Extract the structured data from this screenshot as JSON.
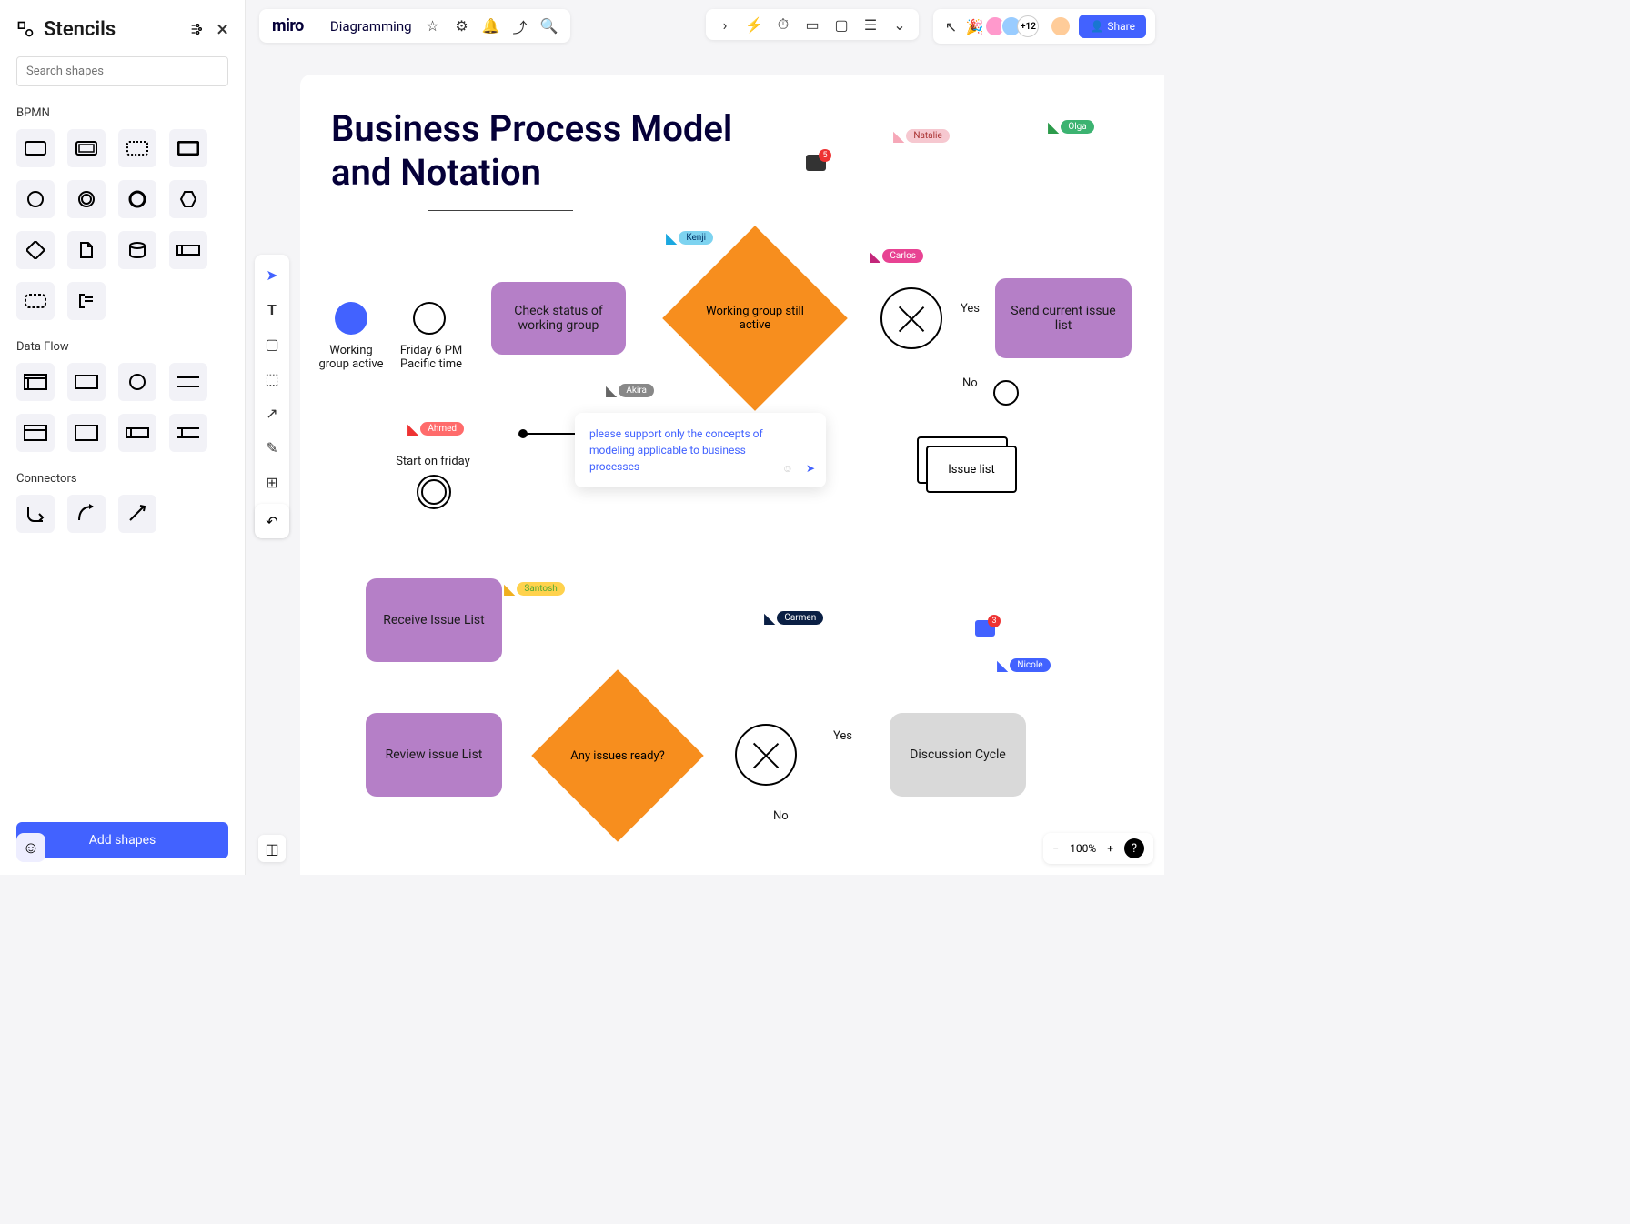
{
  "sidebar": {
    "title": "Stencils",
    "search_placeholder": "Search shapes",
    "sections": {
      "bpmn": "BPMN",
      "dataflow": "Data Flow",
      "connectors": "Connectors"
    },
    "add_shapes": "Add shapes"
  },
  "header": {
    "logo": "miro",
    "board_title": "Diagramming",
    "avatar_count": "+12",
    "share": "Share"
  },
  "canvas": {
    "title_line1": "Business Process Model",
    "title_line2": "and Notation",
    "nodes": {
      "check_status": "Check status of working group",
      "working_active_decision": "Working group still active",
      "send_issue": "Send current issue list",
      "receive_issue": "Receive Issue List",
      "review_issue": "Review issue List",
      "any_issues": "Any issues ready?",
      "discussion": "Discussion Cycle",
      "issue_list": "Issue list"
    },
    "labels": {
      "working_group_active": "Working group active",
      "friday_label": "Friday 6 PM Pacific time",
      "start_friday": "Start on friday",
      "yes1": "Yes",
      "no1": "No",
      "yes2": "Yes",
      "no2": "No"
    },
    "comment": {
      "text": "please support only the concepts of modeling applicable to business processes"
    },
    "users": {
      "natalie": "Natalie",
      "olga": "Olga",
      "kenji": "Kenji",
      "carlos": "Carlos",
      "akira": "Akira",
      "ahmed": "Ahmed",
      "santosh": "Santosh",
      "carmen": "Carmen",
      "nicole": "Nicole"
    },
    "chat_count1": "5",
    "chat_count2": "3"
  },
  "zoom": {
    "level": "100%"
  }
}
